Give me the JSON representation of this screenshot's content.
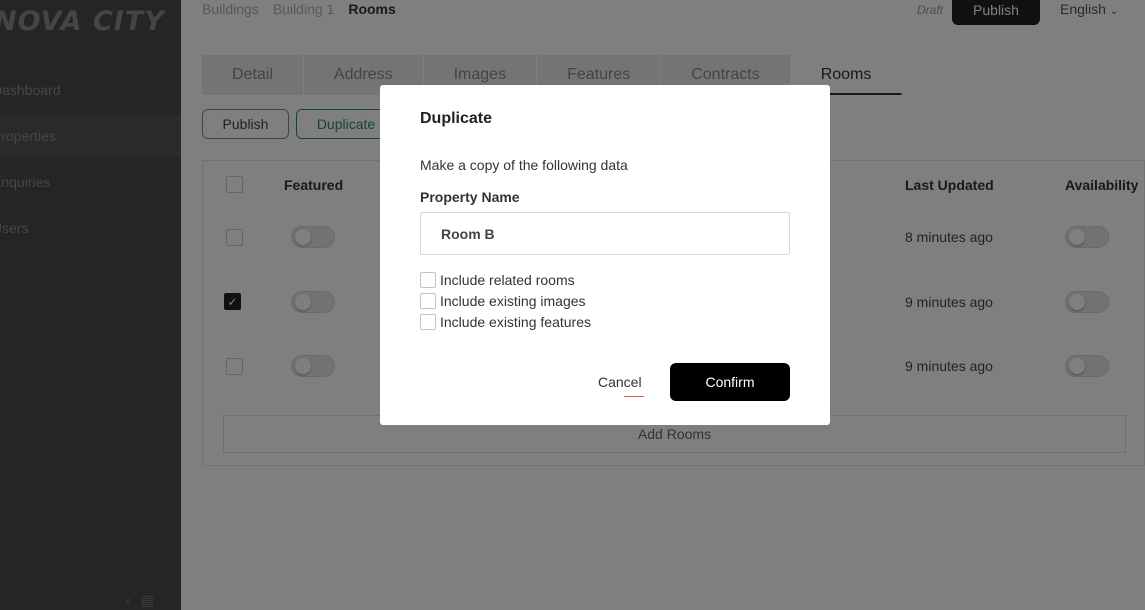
{
  "sidebar": {
    "logo": "NOVA CITY",
    "items": [
      {
        "label": "Dashboard"
      },
      {
        "label": "Properties"
      },
      {
        "label": "Enquiries"
      },
      {
        "label": "Users"
      }
    ],
    "collapse_icon": "chevron-left-icon",
    "chat_icon": "message-icon"
  },
  "header": {
    "breadcrumb": [
      "Buildings",
      "Building 1",
      "Rooms"
    ],
    "status": "Draft",
    "publish_label": "Publish",
    "language": "English"
  },
  "tabs": [
    "Detail",
    "Address",
    "Images",
    "Features",
    "Contracts",
    "Rooms"
  ],
  "active_tab": "Rooms",
  "actions": {
    "publish_label": "Publish",
    "duplicate_label": "Duplicate"
  },
  "table": {
    "columns": {
      "featured": "Featured",
      "last_updated": "Last Updated",
      "availability": "Availability"
    },
    "rows": [
      {
        "checked": false,
        "last_updated": "8 minutes ago"
      },
      {
        "checked": true,
        "last_updated": "9 minutes ago"
      },
      {
        "checked": false,
        "last_updated": "9 minutes ago"
      }
    ],
    "add_label": "Add Rooms"
  },
  "modal": {
    "title": "Duplicate",
    "description": "Make a copy of the following data",
    "field_label": "Property Name",
    "field_value": "Room B",
    "options": [
      {
        "label": "Include related rooms",
        "checked": false
      },
      {
        "label": "Include existing images",
        "checked": false
      },
      {
        "label": "Include existing features",
        "checked": false
      }
    ],
    "cancel_label": "Cancel",
    "confirm_label": "Confirm"
  }
}
